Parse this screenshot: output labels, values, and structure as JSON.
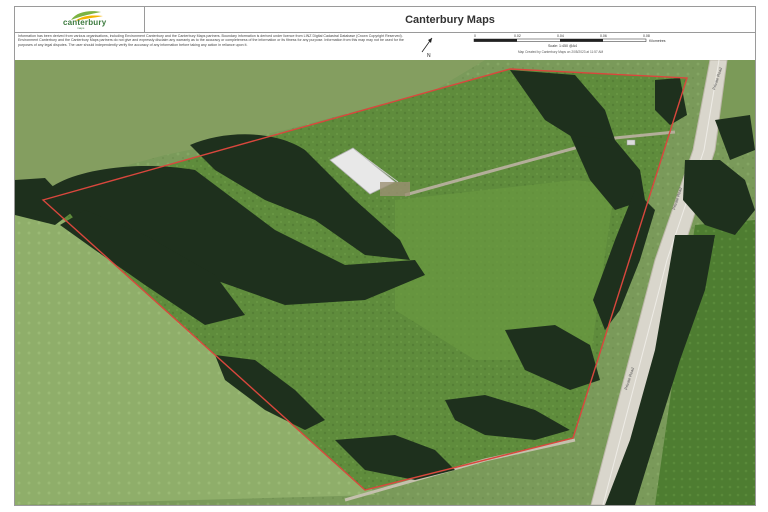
{
  "header": {
    "logo_text": "canterbury",
    "logo_sub": "maps",
    "title": "Canterbury Maps"
  },
  "disclaimer": "Information has been derived from various organisations, including Environment Canterbury and the Canterbury Maps partners. Boundary information is derived under licence from LINZ Digital Cadastral Database (Crown Copyright Reserved). Environment Canterbury and the Canterbury Maps partners do not give and expressly disclaim any warranty as to the accuracy or completeness of the information or its fitness for any purpose. Information from this map may not be used for the purposes of any legal disputes. The user should independently verify the accuracy of any information before taking any action in reliance upon it.",
  "north_label": "N",
  "scale": {
    "ticks": [
      "0",
      "0.02",
      "0.04",
      "0.06",
      "0.08"
    ],
    "unit": "Kilometres",
    "ratio": "Scale: 1:450 @A4",
    "footer": "Map Created by Canterbury Maps on 2/05/2023 at 11:57 AM"
  },
  "map": {
    "road_label": "Private Road",
    "boundary_color": "#d9473d",
    "pasture_color": "#5c8a3a",
    "tree_color": "#1c2e1c"
  }
}
